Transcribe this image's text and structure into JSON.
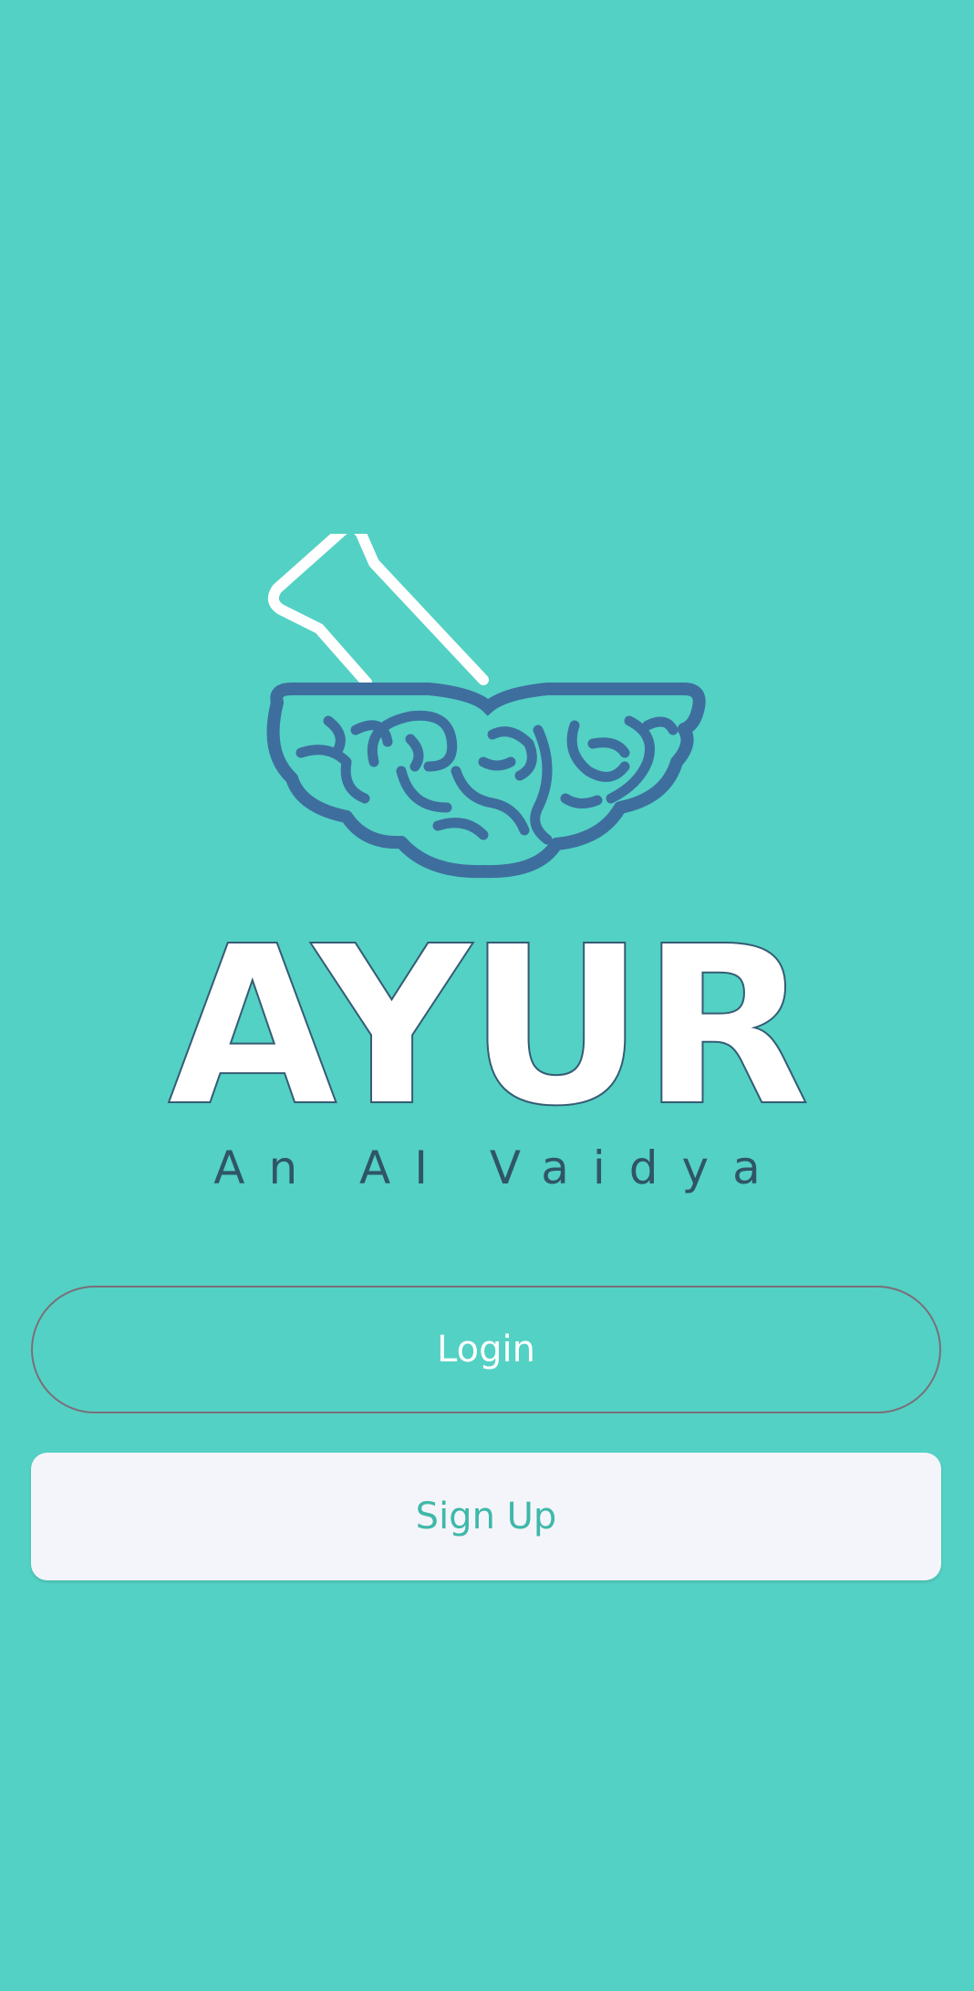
{
  "app": {
    "title": "AYUR",
    "tagline": "An AI Vaidya"
  },
  "logo": {
    "icon": "mortar-pestle-brain-icon"
  },
  "actions": {
    "login_label": "Login",
    "signup_label": "Sign Up"
  },
  "colors": {
    "background": "#53d1c4",
    "brain": "#3e6e9e",
    "title": "#ffffff",
    "tagline": "#2f5566",
    "signup_text": "#3fb8aa",
    "signup_background": "#f4f5fa"
  }
}
